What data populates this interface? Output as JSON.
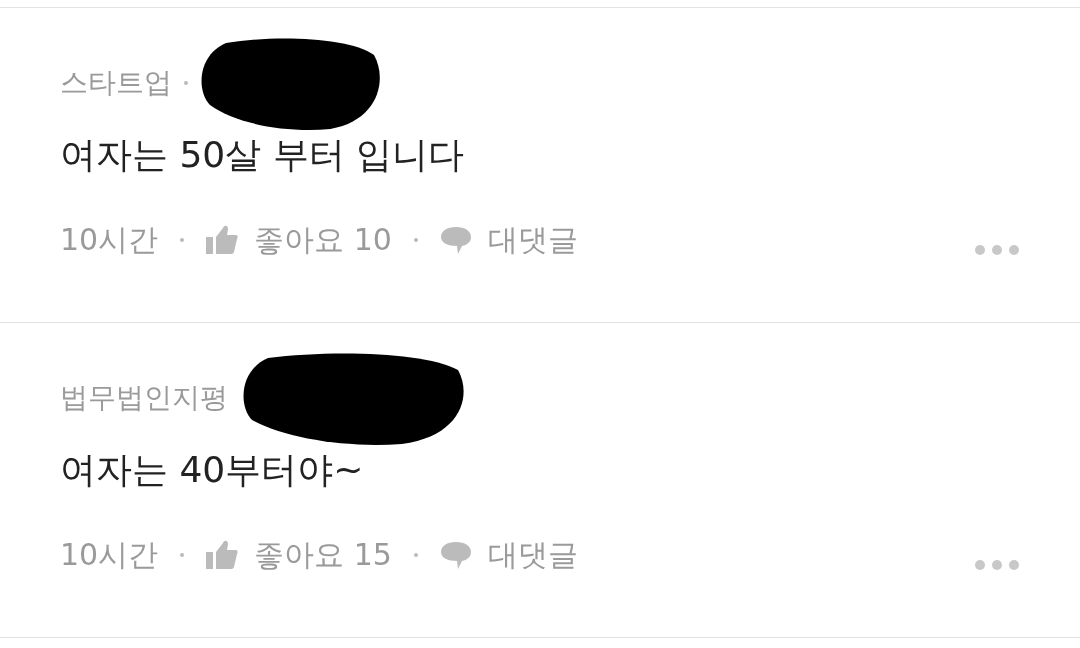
{
  "comments": [
    {
      "company": "스타트업",
      "show_dot": true,
      "redacted": true,
      "text": "여자는 50살 부터 입니다",
      "time": "10시간",
      "like_label": "좋아요 10",
      "reply_label": "대댓글"
    },
    {
      "company": "법무법인지평",
      "show_dot": false,
      "redacted": true,
      "text": "여자는 40부터야~",
      "time": "10시간",
      "like_label": "좋아요 15",
      "reply_label": "대댓글"
    }
  ]
}
